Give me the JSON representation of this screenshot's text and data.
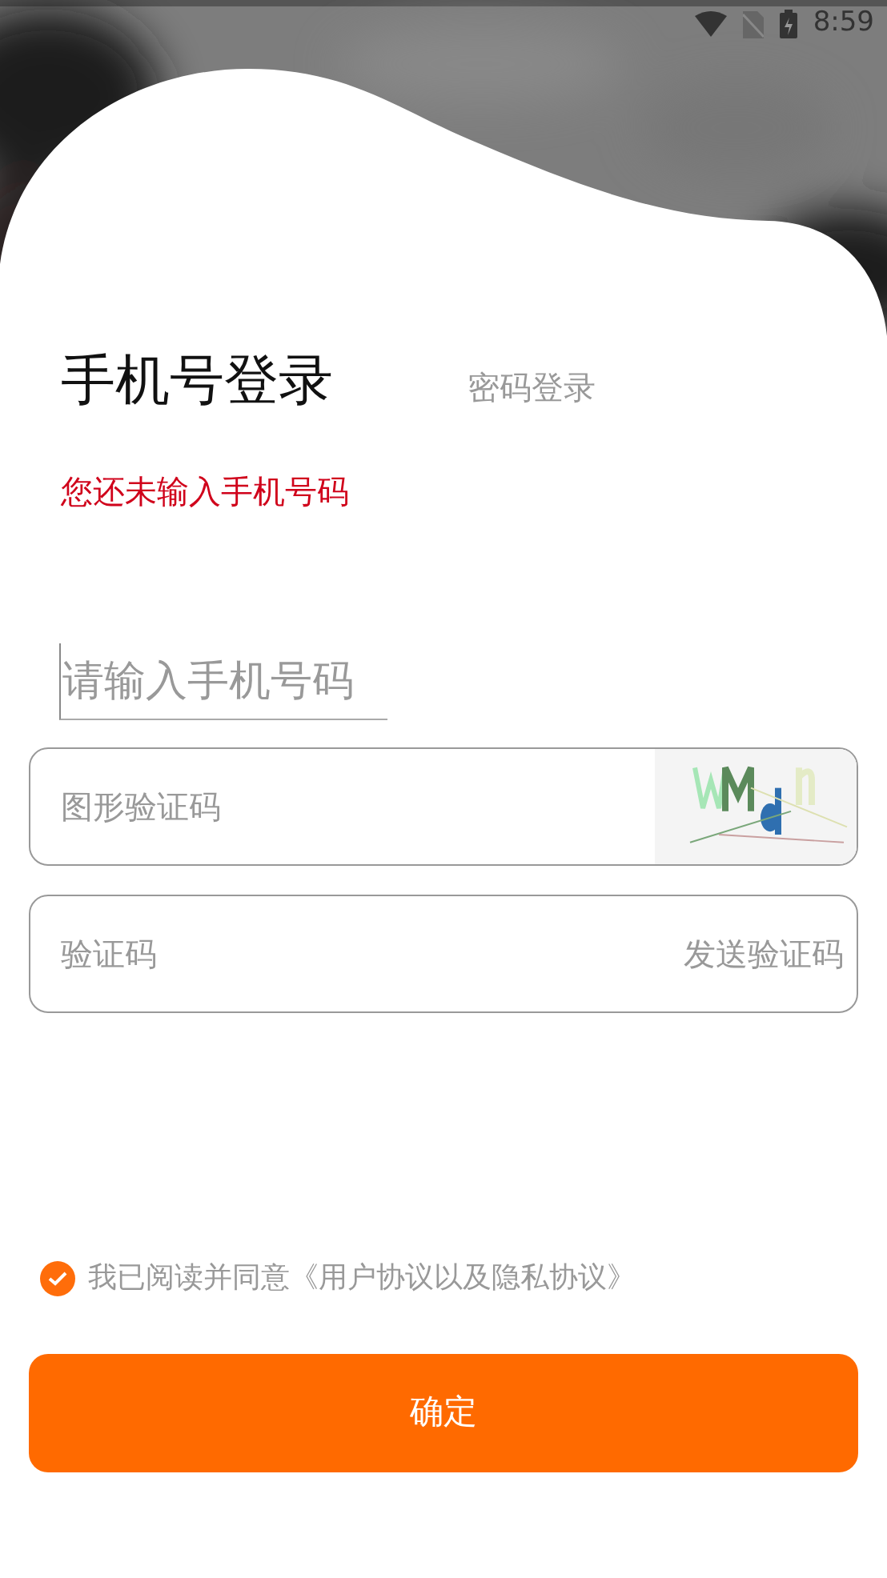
{
  "status_bar": {
    "time": "8:59"
  },
  "tabs": [
    {
      "label": "手机号登录",
      "selected": true
    },
    {
      "label": "密码登录",
      "selected": false
    }
  ],
  "error": "您还未输入手机号码",
  "phone_field": {
    "placeholder": "请输入手机号码"
  },
  "captcha_field": {
    "placeholder": "图形验证码"
  },
  "code_field": {
    "placeholder": "验证码",
    "action": "发送验证码"
  },
  "agreement": {
    "checked": true,
    "text": "我已阅读并同意《用户协议以及隐私协议》"
  },
  "submit": {
    "label": "确定"
  }
}
